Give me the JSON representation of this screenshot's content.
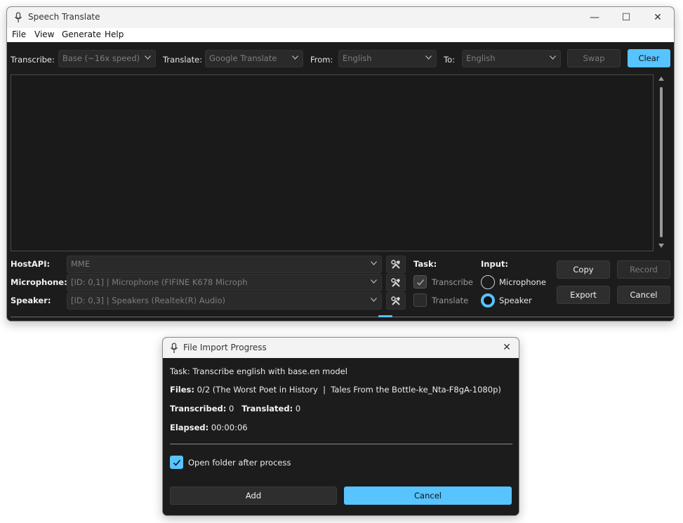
{
  "window": {
    "title": "Speech Translate",
    "controls": {
      "minimize": "—",
      "maximize": "☐",
      "close": "✕"
    }
  },
  "menu": [
    "File",
    "View",
    "Generate",
    "Help"
  ],
  "toolbar": {
    "transcribe_label": "Transcribe:",
    "transcribe_value": "Base (~16x speed)",
    "translate_label": "Translate:",
    "translate_value": "Google Translate",
    "from_label": "From:",
    "from_value": "English",
    "to_label": "To:",
    "to_value": "English",
    "swap_label": "Swap",
    "clear_label": "Clear"
  },
  "devices": {
    "hostapi_label": "HostAPI:",
    "hostapi_value": "MME",
    "microphone_label": "Microphone:",
    "microphone_value": "[ID: 0,1] | Microphone (FIFINE K678 Microph",
    "speaker_label": "Speaker:",
    "speaker_value": "[ID: 0,3] | Speakers (Realtek(R) Audio)"
  },
  "task": {
    "label": "Task:",
    "transcribe_label": "Transcribe",
    "transcribe_checked": true,
    "translate_label": "Translate",
    "translate_checked": false
  },
  "input": {
    "label": "Input:",
    "microphone_label": "Microphone",
    "speaker_label": "Speaker",
    "selected": "Speaker"
  },
  "actions": {
    "copy": "Copy",
    "record": "Record",
    "export": "Export",
    "cancel": "Cancel"
  },
  "dialog": {
    "title": "File Import Progress",
    "close": "✕",
    "task_line": "Task: Transcribe english with base.en model",
    "files_label": "Files:",
    "files_value": "0/2 (The Worst Poet in History  |  Tales From the Bottle-ke_Nta-F8gA-1080p)",
    "transcribed_label": "Transcribed:",
    "transcribed_value": "0",
    "translated_label": "Translated:",
    "translated_value": "0",
    "elapsed_label": "Elapsed:",
    "elapsed_value": "00:00:06",
    "open_folder_label": "Open folder after process",
    "open_folder_checked": true,
    "add_label": "Add",
    "cancel_label": "Cancel"
  },
  "colors": {
    "accent": "#57c3ff",
    "panel": "#1c1c1c",
    "control": "#2a2a2a"
  }
}
